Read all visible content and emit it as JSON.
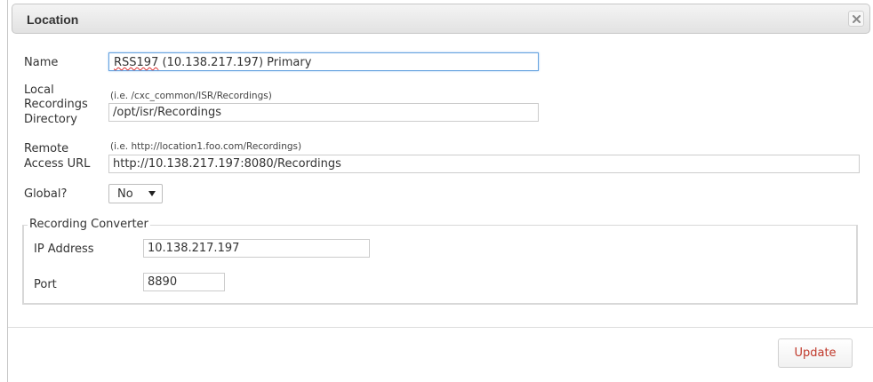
{
  "dialog": {
    "title": "Location",
    "close_icon": "close-icon"
  },
  "form": {
    "name": {
      "label": "Name",
      "value_misspelled": "RSS197",
      "value_rest": " (10.138.217.197) Primary"
    },
    "local_dir": {
      "label_line1": "Local",
      "label_line2": "Recordings",
      "label_line3": "Directory",
      "hint": "(i.e. /cxc_common/ISR/Recordings)",
      "value": "/opt/isr/Recordings"
    },
    "remote_url": {
      "label_line1": "Remote",
      "label_line2": "Access URL",
      "hint": "(i.e. http://location1.foo.com/Recordings)",
      "value": "http://10.138.217.197:8080/Recordings"
    },
    "global": {
      "label": "Global?",
      "selected": "No"
    },
    "recording_converter": {
      "legend": "Recording Converter",
      "ip_label": "IP Address",
      "ip_value": "10.138.217.197",
      "port_label": "Port",
      "port_value": "8890"
    }
  },
  "footer": {
    "update_label": "Update"
  },
  "colors": {
    "accent_text": "#c0392b",
    "focus_border": "#66a3e0"
  }
}
